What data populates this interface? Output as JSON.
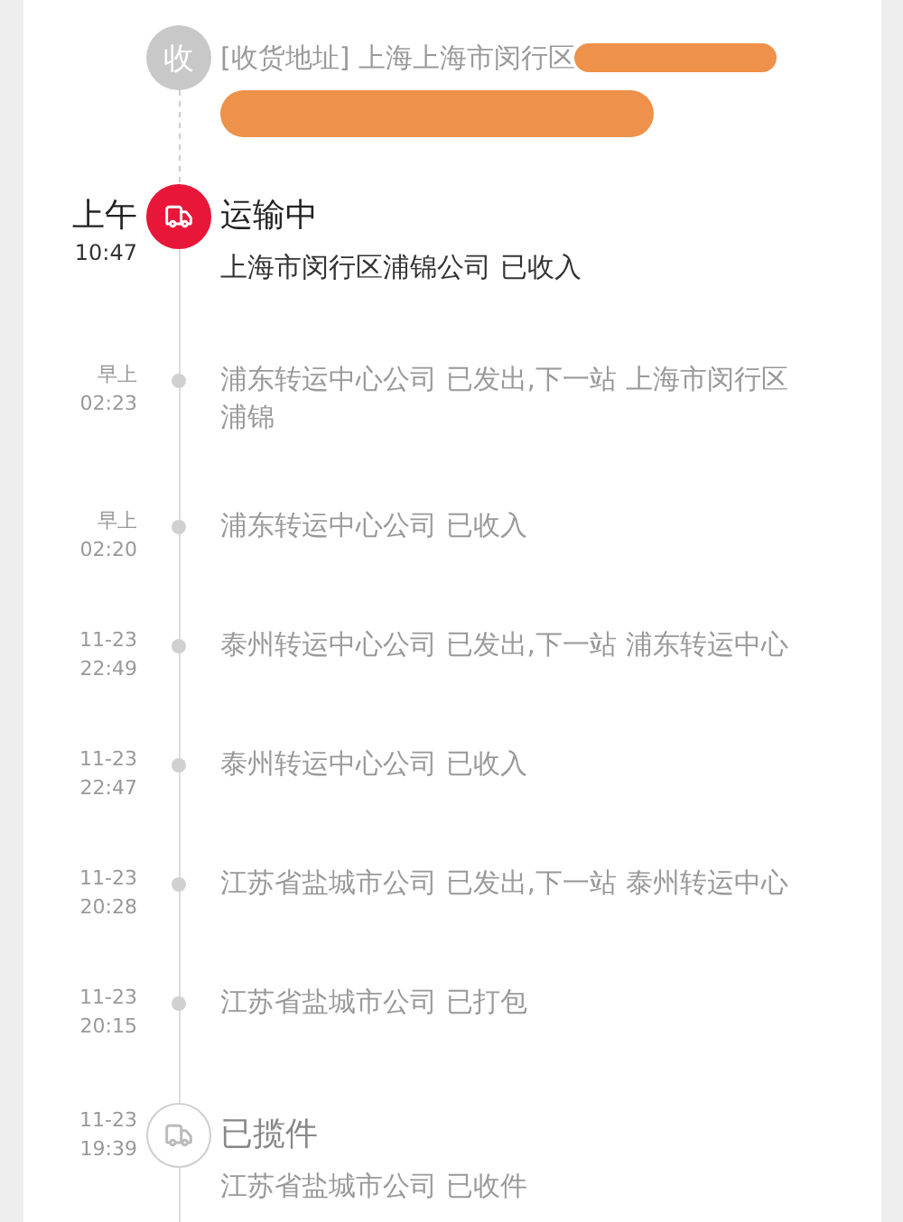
{
  "address": {
    "badge": "收",
    "text": "[收货地址] 上海上海市闵行区"
  },
  "events": [
    {
      "kind": "milestone",
      "active": true,
      "date": "上午",
      "time": "10:47",
      "status": "运输中",
      "detail": "上海市闵行区浦锦公司 已收入"
    },
    {
      "kind": "step",
      "date": "早上",
      "time": "02:23",
      "detail": "浦东转运中心公司 已发出,下一站 上海市闵行区浦锦"
    },
    {
      "kind": "step",
      "date": "早上",
      "time": "02:20",
      "detail": "浦东转运中心公司 已收入"
    },
    {
      "kind": "step",
      "date": "11-23",
      "time": "22:49",
      "detail": "泰州转运中心公司 已发出,下一站 浦东转运中心"
    },
    {
      "kind": "step",
      "date": "11-23",
      "time": "22:47",
      "detail": "泰州转运中心公司 已收入"
    },
    {
      "kind": "step",
      "date": "11-23",
      "time": "20:28",
      "detail": "江苏省盐城市公司 已发出,下一站 泰州转运中心"
    },
    {
      "kind": "step",
      "date": "11-23",
      "time": "20:15",
      "detail": "江苏省盐城市公司 已打包"
    },
    {
      "kind": "milestone",
      "active": false,
      "date": "11-23",
      "time": "19:39",
      "status": "已揽件",
      "detail": "江苏省盐城市公司 已收件"
    }
  ]
}
